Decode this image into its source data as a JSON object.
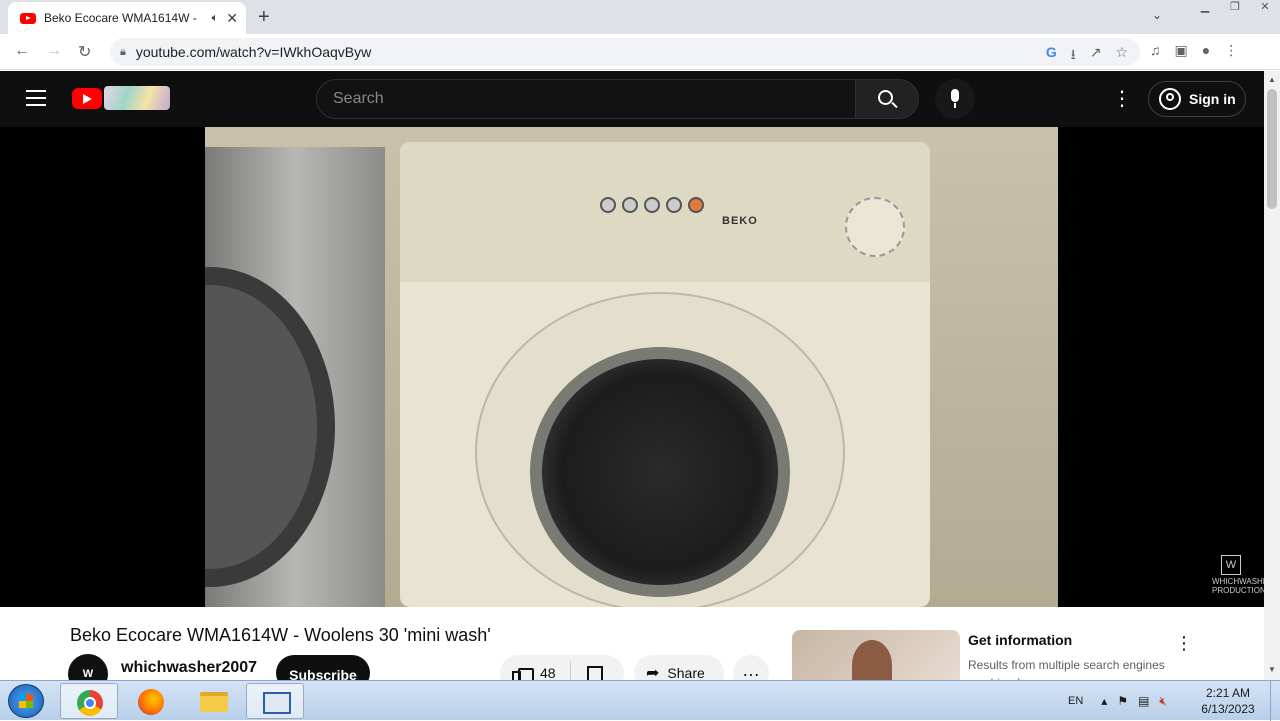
{
  "browser": {
    "tab_title": "Beko Ecocare WMA1614W -",
    "url": "youtube.com/watch?v=IWkhOaqvByw"
  },
  "youtube": {
    "search_placeholder": "Search",
    "sign_in": "Sign in",
    "video": {
      "title": "Beko Ecocare WMA1614W - Woolens 30 'mini wash'",
      "channel": "whichwasher2007",
      "subscribe": "Subscribe",
      "likes": "48",
      "share": "Share",
      "overlay_brand": "BEKO",
      "watermark": "WHICHWASHER PRODUCTIONS"
    },
    "ad": {
      "title": "Get information",
      "description": "Results from multiple search engines combined"
    }
  },
  "taskbar": {
    "lang": "EN",
    "time": "2:21 AM",
    "date": "6/13/2023"
  },
  "icons": {
    "tab": [
      "youtube-favicon",
      "audio-icon",
      "close-icon",
      "new-tab-icon"
    ],
    "nav": [
      "back-icon",
      "forward-icon",
      "reload-icon",
      "lock-icon"
    ],
    "omnibox": [
      "google-icon",
      "install-icon",
      "share-icon",
      "star-icon"
    ],
    "toolbar": [
      "media-icon",
      "side-panel-icon",
      "profile-icon",
      "menu-icon"
    ]
  },
  "colors": {
    "youtube_red": "#ff0000",
    "header_bg": "#0f0f0f",
    "taskbar": "#b8cfe9"
  }
}
